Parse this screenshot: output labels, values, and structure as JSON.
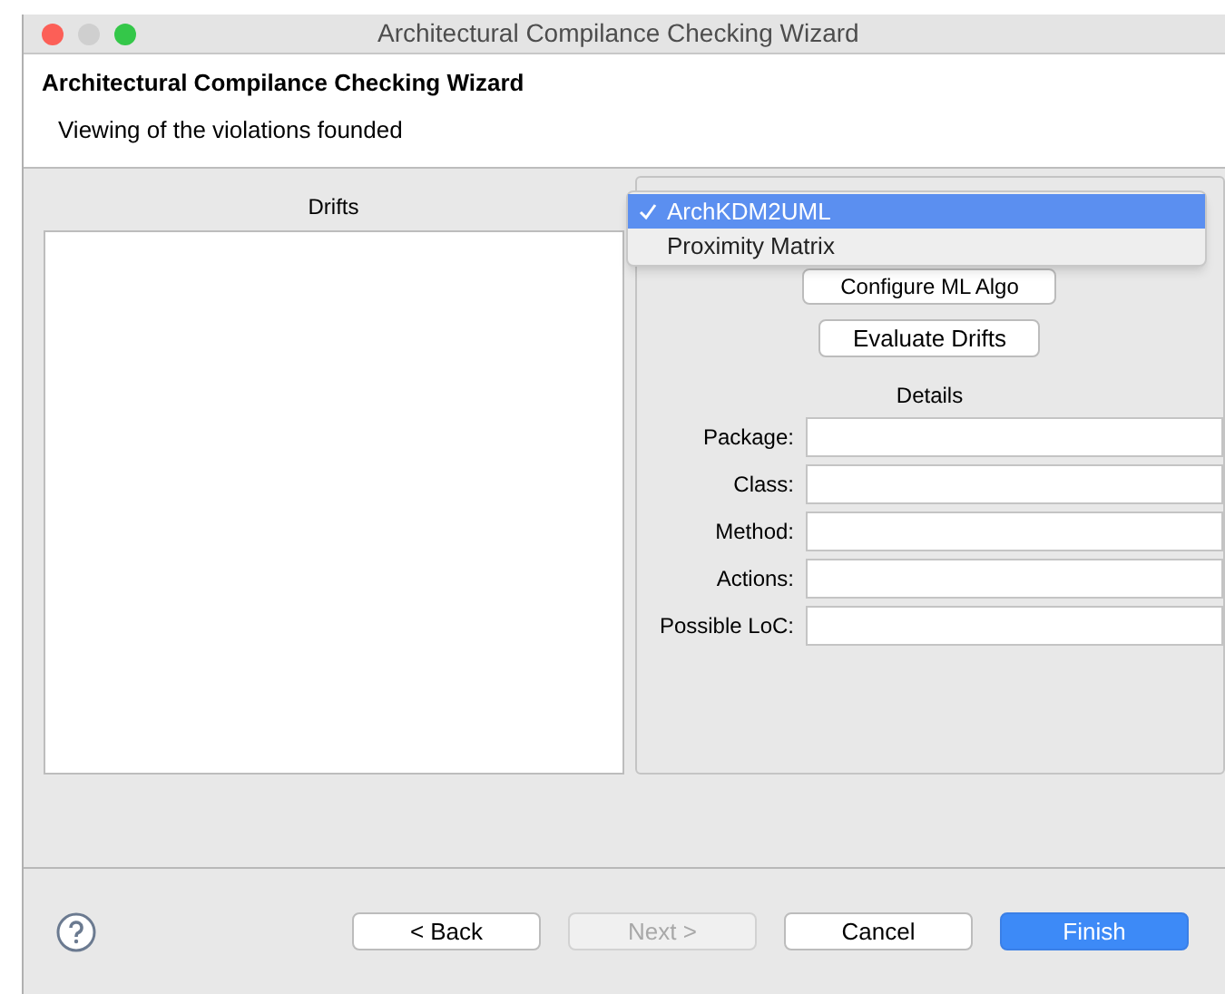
{
  "window": {
    "title": "Architectural Compilance Checking Wizard"
  },
  "header": {
    "title": "Architectural Compilance Checking Wizard",
    "subtitle": "Viewing of the violations founded"
  },
  "drifts": {
    "label": "Drifts"
  },
  "algorithm_menu": {
    "options": [
      {
        "label": "ArchKDM2UML",
        "selected": true
      },
      {
        "label": "Proximity Matrix",
        "selected": false
      }
    ]
  },
  "configure_button": "Configure ML Algo",
  "evaluate_button": "Evaluate Drifts",
  "details": {
    "title": "Details",
    "fields": [
      {
        "label": "Package:"
      },
      {
        "label": "Class:"
      },
      {
        "label": "Method:"
      },
      {
        "label": "Actions:"
      },
      {
        "label": "Possible LoC:"
      }
    ]
  },
  "buttons": [
    {
      "label": "< Back",
      "kind": "normal",
      "disabled": false
    },
    {
      "label": "Next >",
      "kind": "normal",
      "disabled": true
    },
    {
      "label": "Cancel",
      "kind": "normal",
      "disabled": false
    },
    {
      "label": "Finish",
      "kind": "primary",
      "disabled": false
    }
  ]
}
